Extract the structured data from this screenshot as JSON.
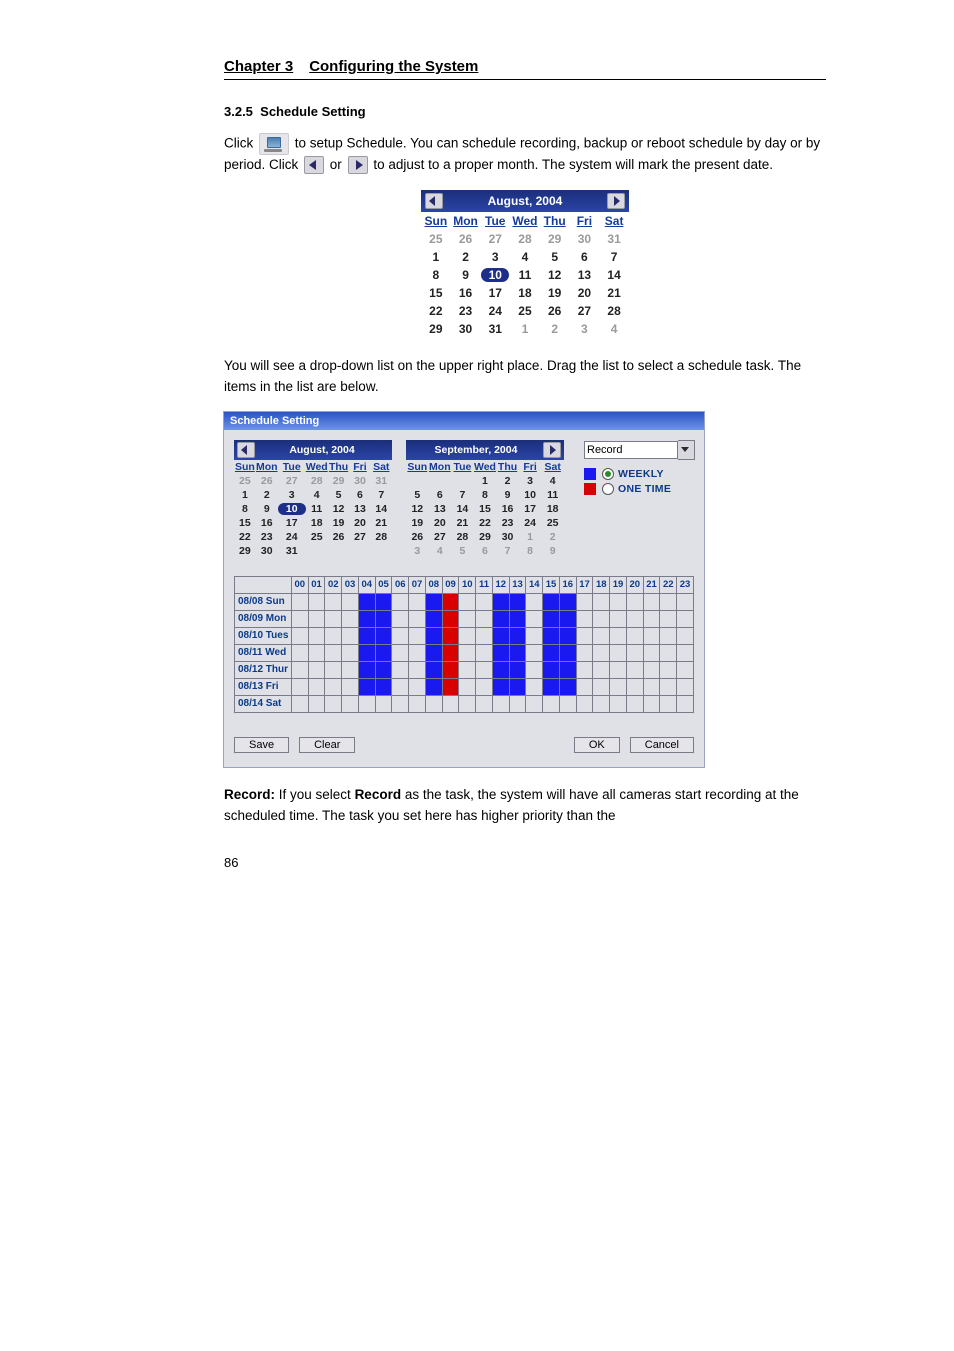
{
  "chapter": {
    "num": "Chapter 3",
    "title": "Configuring the System"
  },
  "section": {
    "num": "3.2.5",
    "title": "Schedule Setting"
  },
  "p1_a": "Click ",
  "p1_b": " to setup Schedule. You can schedule recording, backup or reboot schedule by day or by period. Click ",
  "p1_c": " or ",
  "p1_d": " to adjust to a proper month. The system will mark the present date.",
  "p2": "You will see a drop-down list on the upper right place. Drag the list to select a schedule task. The items in the list are below.",
  "p3_a": "Record:",
  "p3_b": " If you select ",
  "p3_c": "Record",
  "p3_d": " as the task, the system will have all cameras start recording at the scheduled time. The task you set here has higher priority than the",
  "pagenum": "86",
  "dow": [
    "Sun",
    "Mon",
    "Tue",
    "Wed",
    "Thu",
    "Fri",
    "Sat"
  ],
  "cal_big": {
    "title": "August, 2004",
    "today": 10,
    "rows": [
      [
        {
          "n": 25,
          "f": true
        },
        {
          "n": 26,
          "f": true
        },
        {
          "n": 27,
          "f": true
        },
        {
          "n": 28,
          "f": true
        },
        {
          "n": 29,
          "f": true
        },
        {
          "n": 30,
          "f": true
        },
        {
          "n": 31,
          "f": true
        }
      ],
      [
        {
          "n": 1
        },
        {
          "n": 2
        },
        {
          "n": 3
        },
        {
          "n": 4
        },
        {
          "n": 5
        },
        {
          "n": 6
        },
        {
          "n": 7
        }
      ],
      [
        {
          "n": 8
        },
        {
          "n": 9
        },
        {
          "n": 10,
          "t": true
        },
        {
          "n": 11
        },
        {
          "n": 12
        },
        {
          "n": 13
        },
        {
          "n": 14
        }
      ],
      [
        {
          "n": 15
        },
        {
          "n": 16
        },
        {
          "n": 17
        },
        {
          "n": 18
        },
        {
          "n": 19
        },
        {
          "n": 20
        },
        {
          "n": 21
        }
      ],
      [
        {
          "n": 22
        },
        {
          "n": 23
        },
        {
          "n": 24
        },
        {
          "n": 25
        },
        {
          "n": 26
        },
        {
          "n": 27
        },
        {
          "n": 28
        }
      ],
      [
        {
          "n": 29
        },
        {
          "n": 30
        },
        {
          "n": 31
        },
        {
          "n": 1,
          "f": true
        },
        {
          "n": 2,
          "f": true
        },
        {
          "n": 3,
          "f": true
        },
        {
          "n": 4,
          "f": true
        }
      ]
    ]
  },
  "dialog": {
    "title": "Schedule Setting",
    "dropdown": "Record",
    "opt_weekly": "WEEKLY",
    "opt_onetime": "ONE TIME",
    "btn_save": "Save",
    "btn_clear": "Clear",
    "btn_ok": "OK",
    "btn_cancel": "Cancel",
    "cal_left": {
      "title": "August, 2004",
      "today": 10,
      "rows": [
        [
          {
            "n": 25,
            "f": true
          },
          {
            "n": 26,
            "f": true
          },
          {
            "n": 27,
            "f": true
          },
          {
            "n": 28,
            "f": true
          },
          {
            "n": 29,
            "f": true
          },
          {
            "n": 30,
            "f": true
          },
          {
            "n": 31,
            "f": true
          }
        ],
        [
          {
            "n": 1
          },
          {
            "n": 2
          },
          {
            "n": 3
          },
          {
            "n": 4
          },
          {
            "n": 5
          },
          {
            "n": 6
          },
          {
            "n": 7
          }
        ],
        [
          {
            "n": 8
          },
          {
            "n": 9
          },
          {
            "n": 10,
            "t": true
          },
          {
            "n": 11
          },
          {
            "n": 12
          },
          {
            "n": 13
          },
          {
            "n": 14
          }
        ],
        [
          {
            "n": 15
          },
          {
            "n": 16
          },
          {
            "n": 17
          },
          {
            "n": 18
          },
          {
            "n": 19
          },
          {
            "n": 20
          },
          {
            "n": 21
          }
        ],
        [
          {
            "n": 22
          },
          {
            "n": 23
          },
          {
            "n": 24
          },
          {
            "n": 25
          },
          {
            "n": 26
          },
          {
            "n": 27
          },
          {
            "n": 28
          }
        ],
        [
          {
            "n": 29
          },
          {
            "n": 30
          },
          {
            "n": 31
          },
          {
            "n": "",
            "f": true
          },
          {
            "n": "",
            "f": true
          },
          {
            "n": "",
            "f": true
          },
          {
            "n": "",
            "f": true
          }
        ]
      ]
    },
    "cal_right": {
      "title": "September, 2004",
      "rows": [
        [
          {
            "n": "",
            "f": true
          },
          {
            "n": "",
            "f": true
          },
          {
            "n": "",
            "f": true
          },
          {
            "n": 1
          },
          {
            "n": 2
          },
          {
            "n": 3
          },
          {
            "n": 4
          }
        ],
        [
          {
            "n": 5
          },
          {
            "n": 6
          },
          {
            "n": 7
          },
          {
            "n": 8
          },
          {
            "n": 9
          },
          {
            "n": 10
          },
          {
            "n": 11
          }
        ],
        [
          {
            "n": 12
          },
          {
            "n": 13
          },
          {
            "n": 14
          },
          {
            "n": 15
          },
          {
            "n": 16
          },
          {
            "n": 17
          },
          {
            "n": 18
          }
        ],
        [
          {
            "n": 19
          },
          {
            "n": 20
          },
          {
            "n": 21
          },
          {
            "n": 22
          },
          {
            "n": 23
          },
          {
            "n": 24
          },
          {
            "n": 25
          }
        ],
        [
          {
            "n": 26
          },
          {
            "n": 27
          },
          {
            "n": 28
          },
          {
            "n": 29
          },
          {
            "n": 30
          },
          {
            "n": 1,
            "f": true
          },
          {
            "n": 2,
            "f": true
          }
        ],
        [
          {
            "n": 3,
            "f": true
          },
          {
            "n": 4,
            "f": true
          },
          {
            "n": 5,
            "f": true
          },
          {
            "n": 6,
            "f": true
          },
          {
            "n": 7,
            "f": true
          },
          {
            "n": 8,
            "f": true
          },
          {
            "n": 9,
            "f": true
          }
        ]
      ]
    },
    "hours": [
      "00",
      "01",
      "02",
      "03",
      "04",
      "05",
      "06",
      "07",
      "08",
      "09",
      "10",
      "11",
      "12",
      "13",
      "14",
      "15",
      "16",
      "17",
      "18",
      "19",
      "20",
      "21",
      "22",
      "23"
    ],
    "days": [
      {
        "label": "08/08 Sun",
        "cells": [
          "",
          "",
          "",
          "",
          "b",
          "b",
          "",
          "",
          "b",
          "r",
          "",
          "",
          "b",
          "b",
          "",
          "b",
          "b",
          "",
          "",
          "",
          "",
          "",
          "",
          ""
        ]
      },
      {
        "label": "08/09 Mon",
        "cells": [
          "",
          "",
          "",
          "",
          "b",
          "b",
          "",
          "",
          "b",
          "r",
          "",
          "",
          "b",
          "b",
          "",
          "b",
          "b",
          "",
          "",
          "",
          "",
          "",
          "",
          ""
        ]
      },
      {
        "label": "08/10 Tues",
        "cells": [
          "",
          "",
          "",
          "",
          "b",
          "b",
          "",
          "",
          "b",
          "r",
          "",
          "",
          "b",
          "b",
          "",
          "b",
          "b",
          "",
          "",
          "",
          "",
          "",
          "",
          ""
        ]
      },
      {
        "label": "08/11 Wed",
        "cells": [
          "",
          "",
          "",
          "",
          "b",
          "b",
          "",
          "",
          "b",
          "r",
          "",
          "",
          "b",
          "b",
          "",
          "b",
          "b",
          "",
          "",
          "",
          "",
          "",
          "",
          ""
        ]
      },
      {
        "label": "08/12 Thur",
        "cells": [
          "",
          "",
          "",
          "",
          "b",
          "b",
          "",
          "",
          "b",
          "r",
          "",
          "",
          "b",
          "b",
          "",
          "b",
          "b",
          "",
          "",
          "",
          "",
          "",
          "",
          ""
        ]
      },
      {
        "label": "08/13 Fri",
        "cells": [
          "",
          "",
          "",
          "",
          "b",
          "b",
          "",
          "",
          "b",
          "r",
          "",
          "",
          "b",
          "b",
          "",
          "b",
          "b",
          "",
          "",
          "",
          "",
          "",
          "",
          ""
        ]
      },
      {
        "label": "08/14 Sat",
        "cells": [
          "",
          "",
          "",
          "",
          "",
          "",
          "",
          "",
          "",
          "",
          "",
          "",
          "",
          "",
          "",
          "",
          "",
          "",
          "",
          "",
          "",
          "",
          "",
          ""
        ]
      }
    ]
  }
}
